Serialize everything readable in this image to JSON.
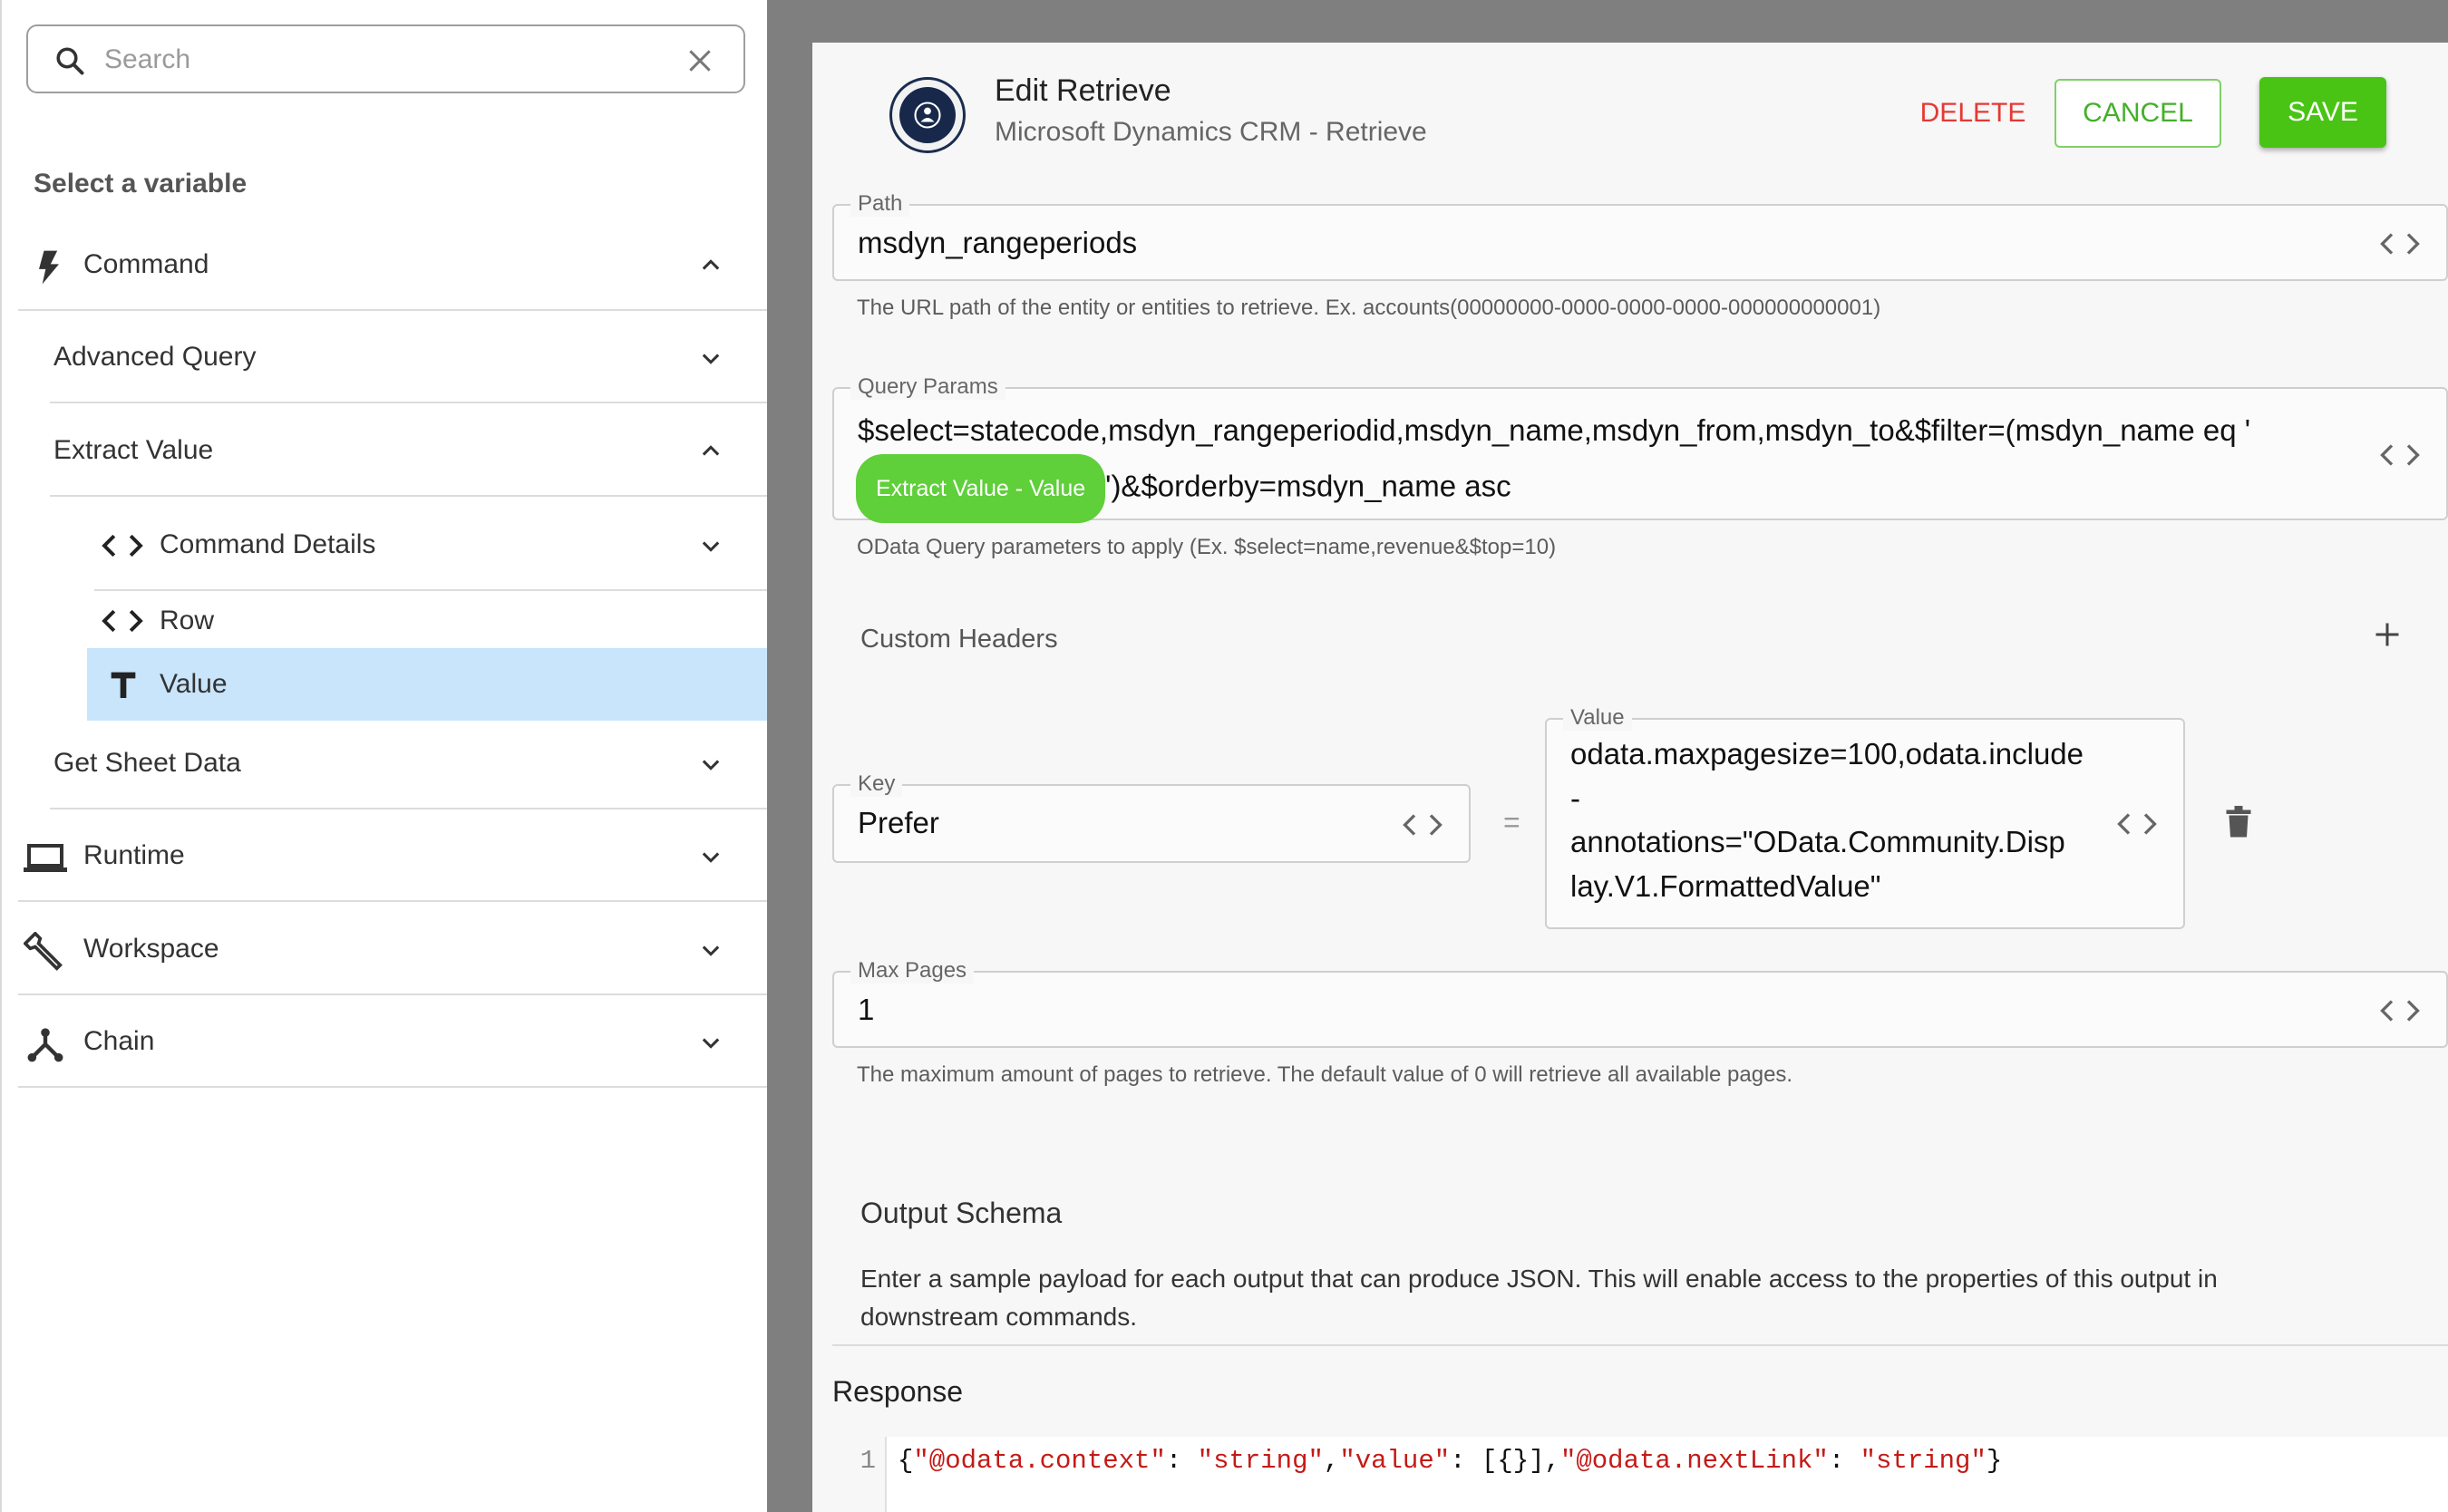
{
  "search": {
    "placeholder": "Search"
  },
  "sidebar": {
    "title": "Select a variable",
    "items": [
      {
        "label": "Command",
        "icon": "bolt-icon"
      },
      {
        "label": "Advanced Query"
      },
      {
        "label": "Extract Value"
      },
      {
        "label": "Command Details",
        "icon": "code-icon"
      },
      {
        "label": "Row",
        "icon": "code-icon"
      },
      {
        "label": "Value",
        "icon": "text-icon",
        "selected": true
      },
      {
        "label": "Get Sheet Data"
      },
      {
        "label": "Runtime",
        "icon": "laptop-icon"
      },
      {
        "label": "Workspace",
        "icon": "wrench-icon"
      },
      {
        "label": "Chain",
        "icon": "chain-icon"
      }
    ]
  },
  "dialog": {
    "title": "Edit Retrieve",
    "subtitle": "Microsoft Dynamics CRM - Retrieve",
    "delete_label": "DELETE",
    "cancel_label": "CANCEL",
    "save_label": "SAVE",
    "path": {
      "label": "Path",
      "value": "msdyn_rangeperiods",
      "help": "The URL path of the entity or entities to retrieve. Ex. accounts(00000000-0000-0000-0000-000000000001)"
    },
    "query_params": {
      "label": "Query Params",
      "line1": "$select=statecode,msdyn_rangeperiodid,msdyn_name,msdyn_from,msdyn_to&$filter=(msdyn_name eq '",
      "pill": "Extract Value - Value",
      "line2": "')&$orderby=msdyn_name asc",
      "help": "OData Query parameters to apply (Ex. $select=name,revenue&$top=10)"
    },
    "custom_headers": {
      "title": "Custom Headers",
      "key_label": "Key",
      "key_value": "Prefer",
      "equals": "=",
      "value_label": "Value",
      "value_lines": [
        "odata.maxpagesize=100,odata.include",
        "-",
        "annotations=\"OData.Community.Disp",
        "lay.V1.FormattedValue\""
      ]
    },
    "max_pages": {
      "label": "Max Pages",
      "value": "1",
      "help": "The maximum amount of pages to retrieve. The default value of 0 will retrieve all available pages."
    },
    "output_schema": {
      "title": "Output Schema",
      "description_line1": "Enter a sample payload for each output that can produce JSON. This will enable access to the properties of this output in",
      "description_line2": "downstream commands.",
      "response_title": "Response",
      "line_number": "1",
      "code_parts": [
        "{",
        "\"@odata.context\"",
        ": ",
        "\"string\"",
        ",",
        "\"value\"",
        ": [{}],",
        "\"@odata.nextLink\"",
        ": ",
        "\"string\"",
        "}"
      ]
    }
  },
  "colors": {
    "accent_green": "#49c414",
    "danger_red": "#e53935",
    "selection_blue": "#c8e5fb",
    "pill_green": "#5fcf3a"
  }
}
